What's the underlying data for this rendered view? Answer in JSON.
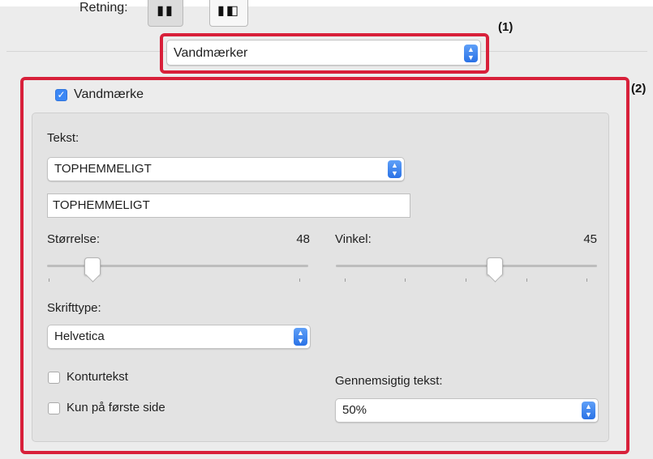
{
  "orientation": {
    "label": "Retning:",
    "portrait_icon": "portrait-orientation-icon",
    "landscape_icon": "landscape-orientation-icon",
    "selected": "portrait"
  },
  "view_popup": {
    "value": "Vandmærker"
  },
  "callouts": {
    "one": "(1)",
    "two": "(2)"
  },
  "watermark": {
    "enabled": true,
    "checkbox_label": "Vandmærke",
    "text_label": "Tekst:",
    "text_popup_value": "TOPHEMMELIGT",
    "text_field_value": "TOPHEMMELIGT",
    "size_label": "Størrelse:",
    "size_value": "48",
    "angle_label": "Vinkel:",
    "angle_value": "45",
    "size_slider_fraction": 0.17,
    "angle_slider_fraction": 0.6,
    "font_label": "Skrifttype:",
    "font_value": "Helvetica",
    "outline_label": "Konturtekst",
    "outline_checked": false,
    "first_page_label": "Kun på første side",
    "first_page_checked": false,
    "transparency_label": "Gennemsigtig tekst:",
    "transparency_value": "50%"
  },
  "colors": {
    "accent": "#3b87f5",
    "callout": "#d8203a",
    "panel": "#ececec",
    "group": "#e3e3e3"
  }
}
